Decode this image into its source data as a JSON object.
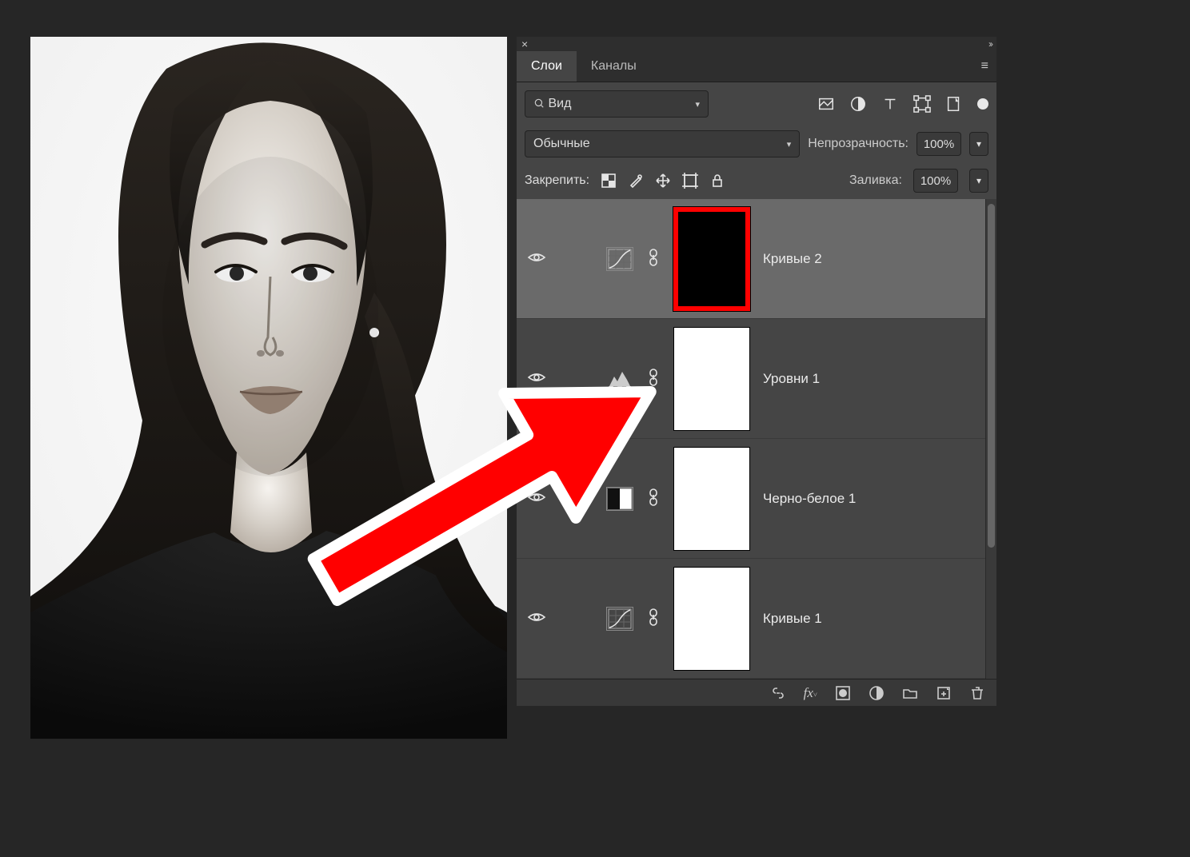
{
  "panel": {
    "tabs": [
      {
        "label": "Слои",
        "active": true
      },
      {
        "label": "Каналы",
        "active": false
      }
    ],
    "filter_kind": "Вид",
    "blend_mode": "Обычные",
    "opacity_label": "Непрозрачность:",
    "opacity_value": "100%",
    "lock_label": "Закрепить:",
    "fill_label": "Заливка:",
    "fill_value": "100%"
  },
  "layers": [
    {
      "name": "Кривые 2",
      "selected": true,
      "adjustment": "curves",
      "mask": "black"
    },
    {
      "name": "Уровни 1",
      "selected": false,
      "adjustment": "levels",
      "mask": "white"
    },
    {
      "name": "Черно-белое 1",
      "selected": false,
      "adjustment": "bw",
      "mask": "white"
    },
    {
      "name": "Кривые 1",
      "selected": false,
      "adjustment": "curves",
      "mask": "white"
    }
  ]
}
